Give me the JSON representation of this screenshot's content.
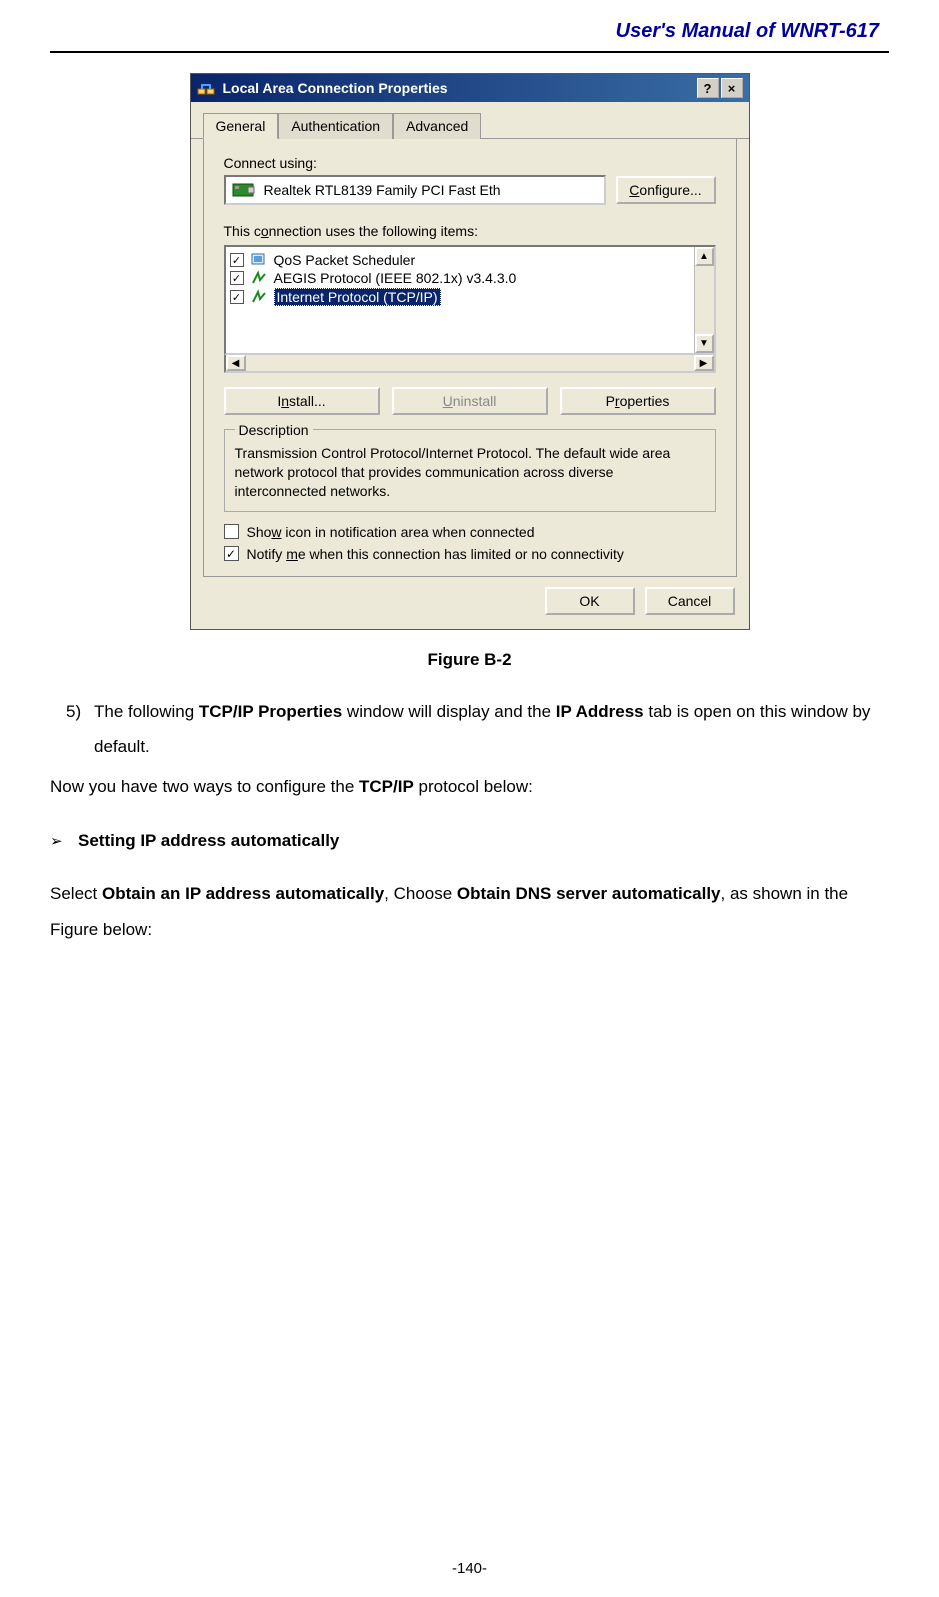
{
  "header": {
    "title": "User's Manual of WNRT-617"
  },
  "dialog": {
    "title": "Local Area Connection    Properties",
    "help_btn": "?",
    "close_btn": "×",
    "tabs": [
      "General",
      "Authentication",
      "Advanced"
    ],
    "connect_label": "Connect using:",
    "adapter": "Realtek RTL8139 Family PCI Fast Eth",
    "configure_btn": "Configure...",
    "items_label": "This connection uses the following items:",
    "items": [
      {
        "checked": true,
        "label": "QoS Packet Scheduler",
        "selected": false
      },
      {
        "checked": true,
        "label": "AEGIS Protocol (IEEE 802.1x) v3.4.3.0",
        "selected": false
      },
      {
        "checked": true,
        "label": "Internet Protocol (TCP/IP)",
        "selected": true
      }
    ],
    "install_btn": "Install...",
    "uninstall_btn": "Uninstall",
    "properties_btn": "Properties",
    "desc_legend": "Description",
    "desc_text": "Transmission Control Protocol/Internet Protocol. The default wide area network protocol that provides communication across diverse interconnected networks.",
    "show_icon_label": "Show icon in notification area when connected",
    "show_icon_checked": false,
    "notify_label": "Notify me when this connection has limited or no connectivity",
    "notify_checked": true,
    "ok_btn": "OK",
    "cancel_btn": "Cancel"
  },
  "caption": "Figure B-2",
  "step": {
    "num": "5)",
    "pre": "The following ",
    "b1": "TCP/IP Properties",
    "mid": " window will display and the ",
    "b2": "IP Address",
    "post": " tab is open on this window by default."
  },
  "config_line": {
    "pre": "Now you have two ways to configure the ",
    "b": "TCP/IP",
    "post": " protocol below:"
  },
  "bullet": {
    "sym": "➢",
    "text": "Setting IP address automatically"
  },
  "select_line": {
    "pre": "Select ",
    "b1": "Obtain an IP address automatically",
    "mid": ", Choose ",
    "b2": "Obtain DNS server automatically",
    "post": ", as shown in the Figure below:"
  },
  "page_num": "-140-"
}
